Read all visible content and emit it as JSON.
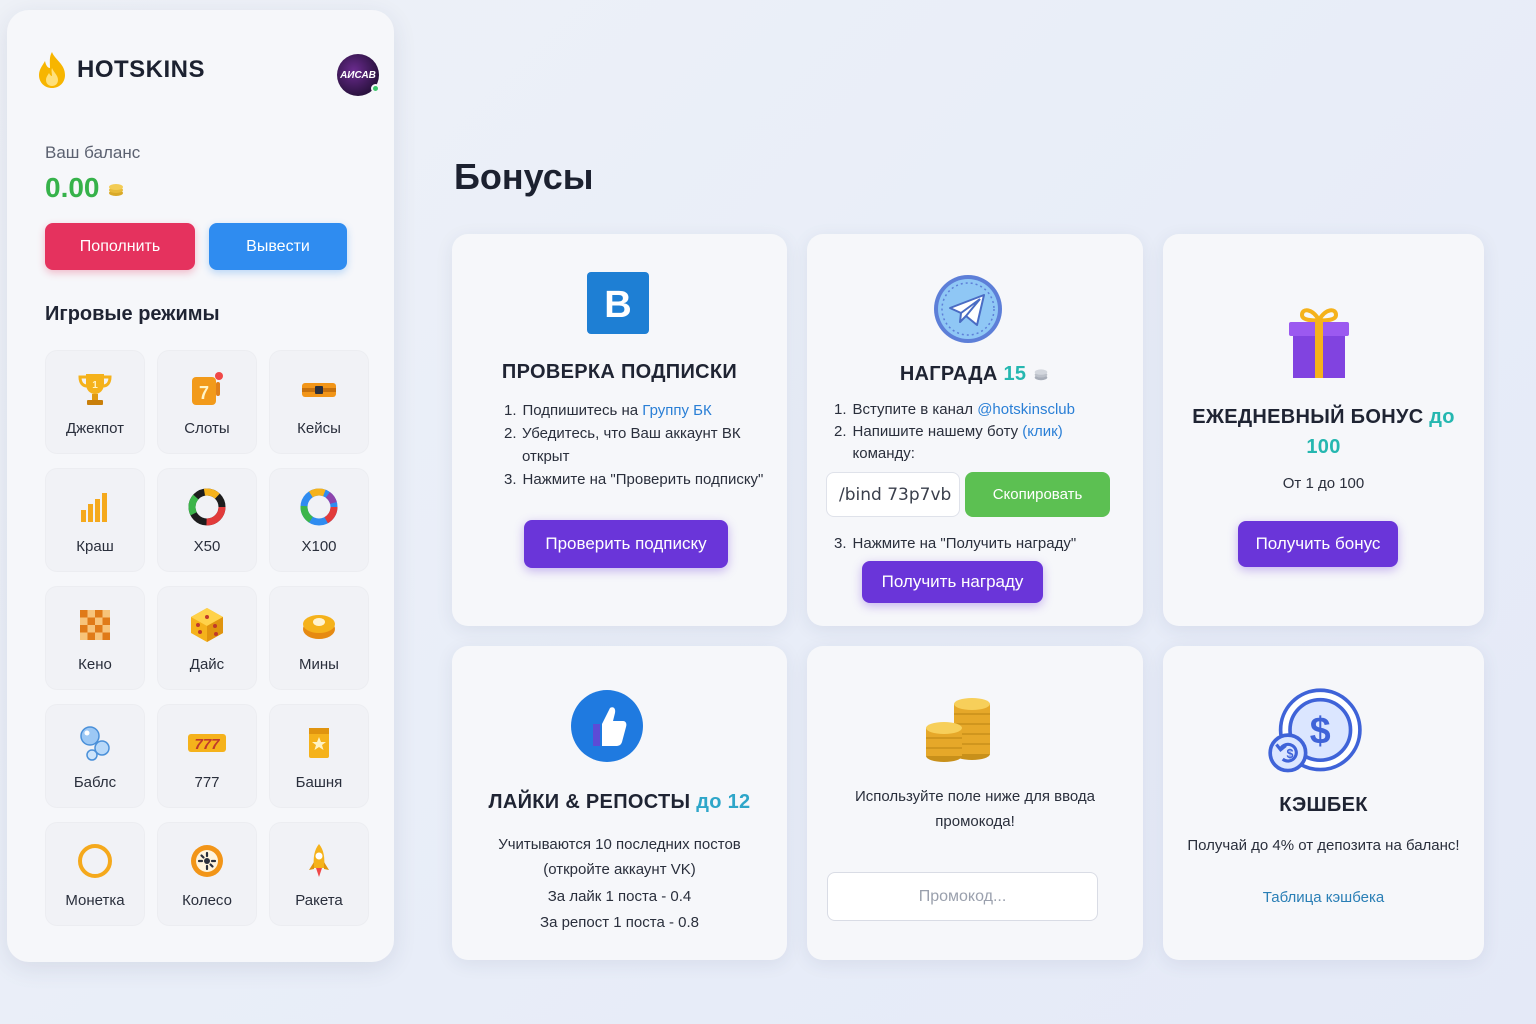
{
  "brand": {
    "name": "HOTSKINS",
    "avatar_text": "АИСАВ"
  },
  "balance": {
    "label": "Ваш баланс",
    "value": "0.00"
  },
  "actions": {
    "deposit": "Пополнить",
    "withdraw": "Вывести"
  },
  "modes": {
    "title": "Игровые режимы",
    "items": [
      {
        "label": "Джекпот",
        "icon": "trophy-icon"
      },
      {
        "label": "Слоты",
        "icon": "slot-seven-icon"
      },
      {
        "label": "Кейсы",
        "icon": "case-icon"
      },
      {
        "label": "Краш",
        "icon": "crash-bars-icon"
      },
      {
        "label": "X50",
        "icon": "x50-wheel-icon"
      },
      {
        "label": "X100",
        "icon": "x100-wheel-icon"
      },
      {
        "label": "Кено",
        "icon": "keno-grid-icon"
      },
      {
        "label": "Дайс",
        "icon": "dice-icon"
      },
      {
        "label": "Мины",
        "icon": "mine-icon"
      },
      {
        "label": "Баблс",
        "icon": "bubbles-icon"
      },
      {
        "label": "777",
        "icon": "triple-seven-icon"
      },
      {
        "label": "Башня",
        "icon": "tower-icon"
      },
      {
        "label": "Монетка",
        "icon": "coin-ring-icon"
      },
      {
        "label": "Колесо",
        "icon": "wheel-icon"
      },
      {
        "label": "Ракета",
        "icon": "rocket-icon"
      }
    ]
  },
  "page": {
    "title": "Бонусы"
  },
  "cards": {
    "subscription": {
      "title": "ПРОВЕРКА ПОДПИСКИ",
      "step1_prefix": "Подпишитесь на ",
      "step1_link": "Группу БК",
      "step2": "Убедитесь, что Ваш аккаунт ВК открыт",
      "step3": "Нажмите на \"Проверить подписку\"",
      "button": "Проверить подписку"
    },
    "reward": {
      "title": "НАГРАДА",
      "amount": "15",
      "step1_prefix": "Вступите в канал ",
      "step1_link": "@hotskinsclub",
      "step2_prefix": "Напишите нашему боту ",
      "step2_link": "(клик)",
      "step2_suffix": "команду:",
      "command": "/bind 73p7vb",
      "copy_button": "Скопировать",
      "step3": "Нажмите на \"Получить награду\"",
      "button": "Получить награду"
    },
    "daily": {
      "title": "ЕЖЕДНЕВНЫЙ БОНУС",
      "accent_prefix": "до",
      "accent_value": "100",
      "subtitle": "От 1 до 100",
      "button": "Получить бонус"
    },
    "likes": {
      "title": "ЛАЙКИ & РЕПОСТЫ",
      "accent": "до 12",
      "line1": "Учитываются 10 последних постов",
      "line2": "(откройте аккаунт VK)",
      "line3": "За лайк 1 поста - 0.4",
      "line4": "За репост 1 поста - 0.8"
    },
    "promo": {
      "text_line1": "Используйте поле ниже для ввода",
      "text_line2": "промокода!",
      "placeholder": "Промокод..."
    },
    "cashback": {
      "title": "КЭШБЕК",
      "text": "Получай до 4% от депозита на баланс!",
      "link": "Таблица кэшбека"
    }
  },
  "colors": {
    "green": "#36b24a",
    "pink": "#e5325e",
    "blue": "#2f8cf0",
    "purple": "#6a35d9",
    "teal": "#25b7b0",
    "copy_green": "#5cc052"
  }
}
